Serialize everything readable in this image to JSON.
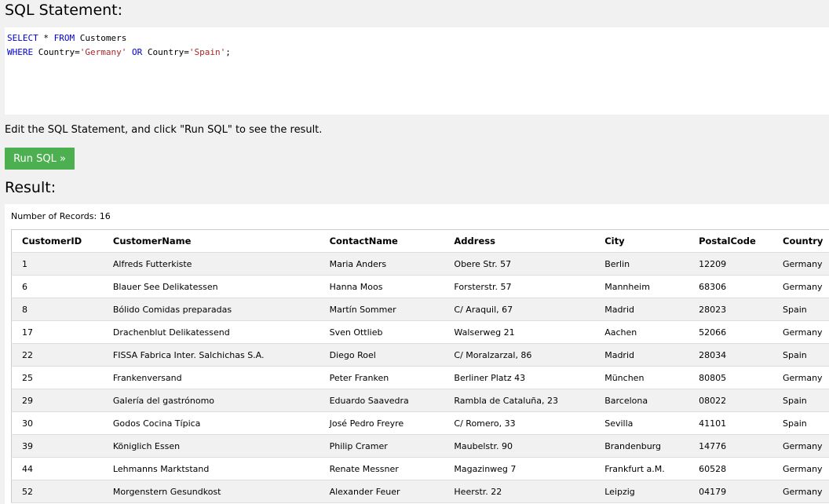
{
  "sql_section": {
    "title": "SQL Statement:",
    "code": {
      "line1": {
        "kw1": "SELECT",
        "mid1": " * ",
        "kw2": "FROM",
        "rest": " Customers"
      },
      "line2": {
        "kw1": "WHERE",
        "p1": " Country=",
        "s1": "'Germany'",
        "p2": " ",
        "kw2": "OR",
        "p3": " Country=",
        "s2": "'Spain'",
        "end": ";"
      }
    },
    "instruction": "Edit the SQL Statement, and click \"Run SQL\" to see the result.",
    "run_button": "Run SQL »"
  },
  "result": {
    "title": "Result:",
    "record_count": "Number of Records: 16",
    "columns": [
      "CustomerID",
      "CustomerName",
      "ContactName",
      "Address",
      "City",
      "PostalCode",
      "Country"
    ],
    "rows": [
      [
        "1",
        "Alfreds Futterkiste",
        "Maria Anders",
        "Obere Str. 57",
        "Berlin",
        "12209",
        "Germany"
      ],
      [
        "6",
        "Blauer See Delikatessen",
        "Hanna Moos",
        "Forsterstr. 57",
        "Mannheim",
        "68306",
        "Germany"
      ],
      [
        "8",
        "Bólido Comidas preparadas",
        "Martín Sommer",
        "C/ Araquil, 67",
        "Madrid",
        "28023",
        "Spain"
      ],
      [
        "17",
        "Drachenblut Delikatessend",
        "Sven Ottlieb",
        "Walserweg 21",
        "Aachen",
        "52066",
        "Germany"
      ],
      [
        "22",
        "FISSA Fabrica Inter. Salchichas S.A.",
        "Diego Roel",
        "C/ Moralzarzal, 86",
        "Madrid",
        "28034",
        "Spain"
      ],
      [
        "25",
        "Frankenversand",
        "Peter Franken",
        "Berliner Platz 43",
        "München",
        "80805",
        "Germany"
      ],
      [
        "29",
        "Galería del gastrónomo",
        "Eduardo Saavedra",
        "Rambla de Cataluña, 23",
        "Barcelona",
        "08022",
        "Spain"
      ],
      [
        "30",
        "Godos Cocina Típica",
        "José Pedro Freyre",
        "C/ Romero, 33",
        "Sevilla",
        "41101",
        "Spain"
      ],
      [
        "39",
        "Königlich Essen",
        "Philip Cramer",
        "Maubelstr. 90",
        "Brandenburg",
        "14776",
        "Germany"
      ],
      [
        "44",
        "Lehmanns Marktstand",
        "Renate Messner",
        "Magazinweg 7",
        "Frankfurt a.M.",
        "60528",
        "Germany"
      ],
      [
        "52",
        "Morgenstern Gesundkost",
        "Alexander Feuer",
        "Heerstr. 22",
        "Leipzig",
        "04179",
        "Germany"
      ]
    ]
  }
}
